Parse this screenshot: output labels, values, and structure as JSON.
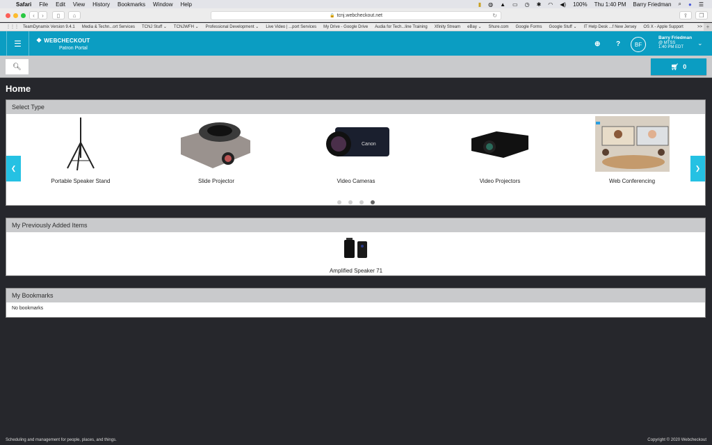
{
  "macos_menubar": {
    "app": "Safari",
    "menus": [
      "File",
      "Edit",
      "View",
      "History",
      "Bookmarks",
      "Window",
      "Help"
    ],
    "battery": "100%",
    "clock": "Thu 1:40 PM",
    "user": "Barry Friedman"
  },
  "browser": {
    "url": "tcnj.webcheckout.net",
    "bookmarks": [
      "TeamDynamix Version 9.4.1",
      "Media & Techn...ort Services",
      "TCNJ Stuff ⌄",
      "TCNJWFH ⌄",
      "Professional Development ⌄",
      "Live Video | ...port Services",
      "My Drive - Google Drive",
      "Audia for Tech...line Training",
      "Xfinity Stream",
      "eBay ⌄",
      "Shure.com",
      "Google Forms",
      "Google Stuff ⌄",
      "IT Help Desk ...f New Jersey",
      "OS X - Apple Support"
    ],
    "more": ">>"
  },
  "appbar": {
    "brand": "WEBCHECKOUT",
    "subtitle": "Patron Portal",
    "help": "?",
    "avatar_initials": "BF",
    "user_name": "Barry Friedman",
    "user_org": "@ MTSS",
    "user_time": "1:40 PM EDT",
    "accent": "#0b9dc2"
  },
  "actionbar": {
    "cart_count": "0"
  },
  "page": {
    "title": "Home"
  },
  "select_type": {
    "header": "Select Type",
    "items": [
      {
        "label": "Portable Speaker Stand",
        "icon": "speaker-stand-image"
      },
      {
        "label": "Slide Projector",
        "icon": "slide-projector-image"
      },
      {
        "label": "Video Cameras",
        "icon": "video-camera-image"
      },
      {
        "label": "Video Projectors",
        "icon": "video-projector-image"
      },
      {
        "label": "Web Conferencing",
        "icon": "web-conferencing-image"
      }
    ],
    "pages": 4,
    "active_page": 4
  },
  "previous_items": {
    "header": "My Previously Added Items",
    "items": [
      {
        "label": "Amplified Speaker 71"
      }
    ]
  },
  "bookmarks_panel": {
    "header": "My Bookmarks",
    "empty_text": "No bookmarks"
  },
  "footer": {
    "left": "Scheduling and management for people, places, and things.",
    "right": "Copyright © 2020 Webcheckout"
  }
}
